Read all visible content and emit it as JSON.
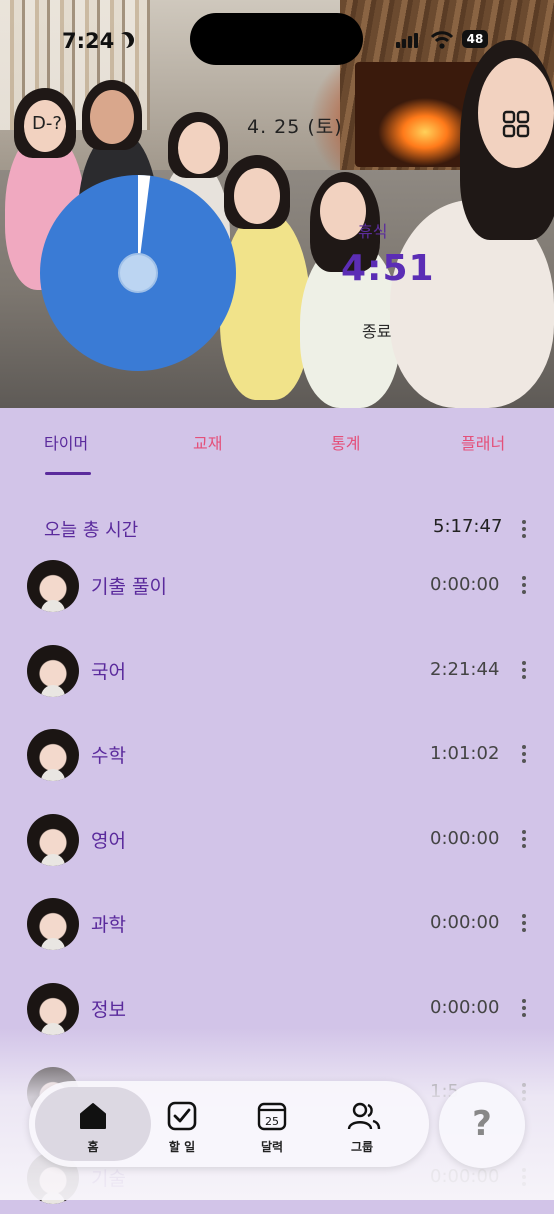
{
  "status": {
    "time": "7:24",
    "battery": "48"
  },
  "hero": {
    "dday": "D-?",
    "date": "4. 25 (토)",
    "rest_label": "휴식",
    "rest_time": "4:51",
    "end_label": "종료",
    "dial_progress": 0.02
  },
  "tabs": [
    {
      "label": "타이머",
      "active": true
    },
    {
      "label": "교재",
      "active": false
    },
    {
      "label": "통계",
      "active": false
    },
    {
      "label": "플래너",
      "active": false
    }
  ],
  "total": {
    "label": "오늘 총 시간",
    "value": "5:17:47"
  },
  "subjects": [
    {
      "name": "기출 풀이",
      "time": "0:00:00"
    },
    {
      "name": "국어",
      "time": "2:21:44"
    },
    {
      "name": "수학",
      "time": "1:01:02"
    },
    {
      "name": "영어",
      "time": "0:00:00"
    },
    {
      "name": "과학",
      "time": "0:00:00"
    },
    {
      "name": "정보",
      "time": "0:00:00"
    },
    {
      "name": "",
      "time": "1:5"
    },
    {
      "name": "기술",
      "time": "0:00:00"
    }
  ],
  "nav": {
    "home": "홈",
    "todo": "할 일",
    "calendar": "달력",
    "calendar_day": "25",
    "group": "그룹",
    "help": "?"
  },
  "colors": {
    "accent": "#5a2a9c",
    "tab_inactive": "#e4507a",
    "dial": "#3a7bd5",
    "sheet_bg": "#d2c4e8"
  }
}
